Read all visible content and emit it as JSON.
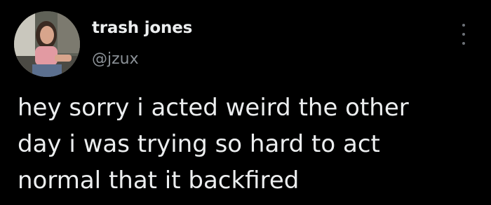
{
  "author": {
    "display_name": "trash jones",
    "handle": "@jzux",
    "avatar_icon": "profile-photo"
  },
  "menu": {
    "icon": "more-vertical-icon"
  },
  "tweet": {
    "lines": [
      "hey sorry i acted weird the other",
      "day i was trying so hard to act",
      "normal that it backfired"
    ]
  },
  "colors": {
    "background": "#000000",
    "text": "#eceeef",
    "muted": "#8b9197"
  }
}
